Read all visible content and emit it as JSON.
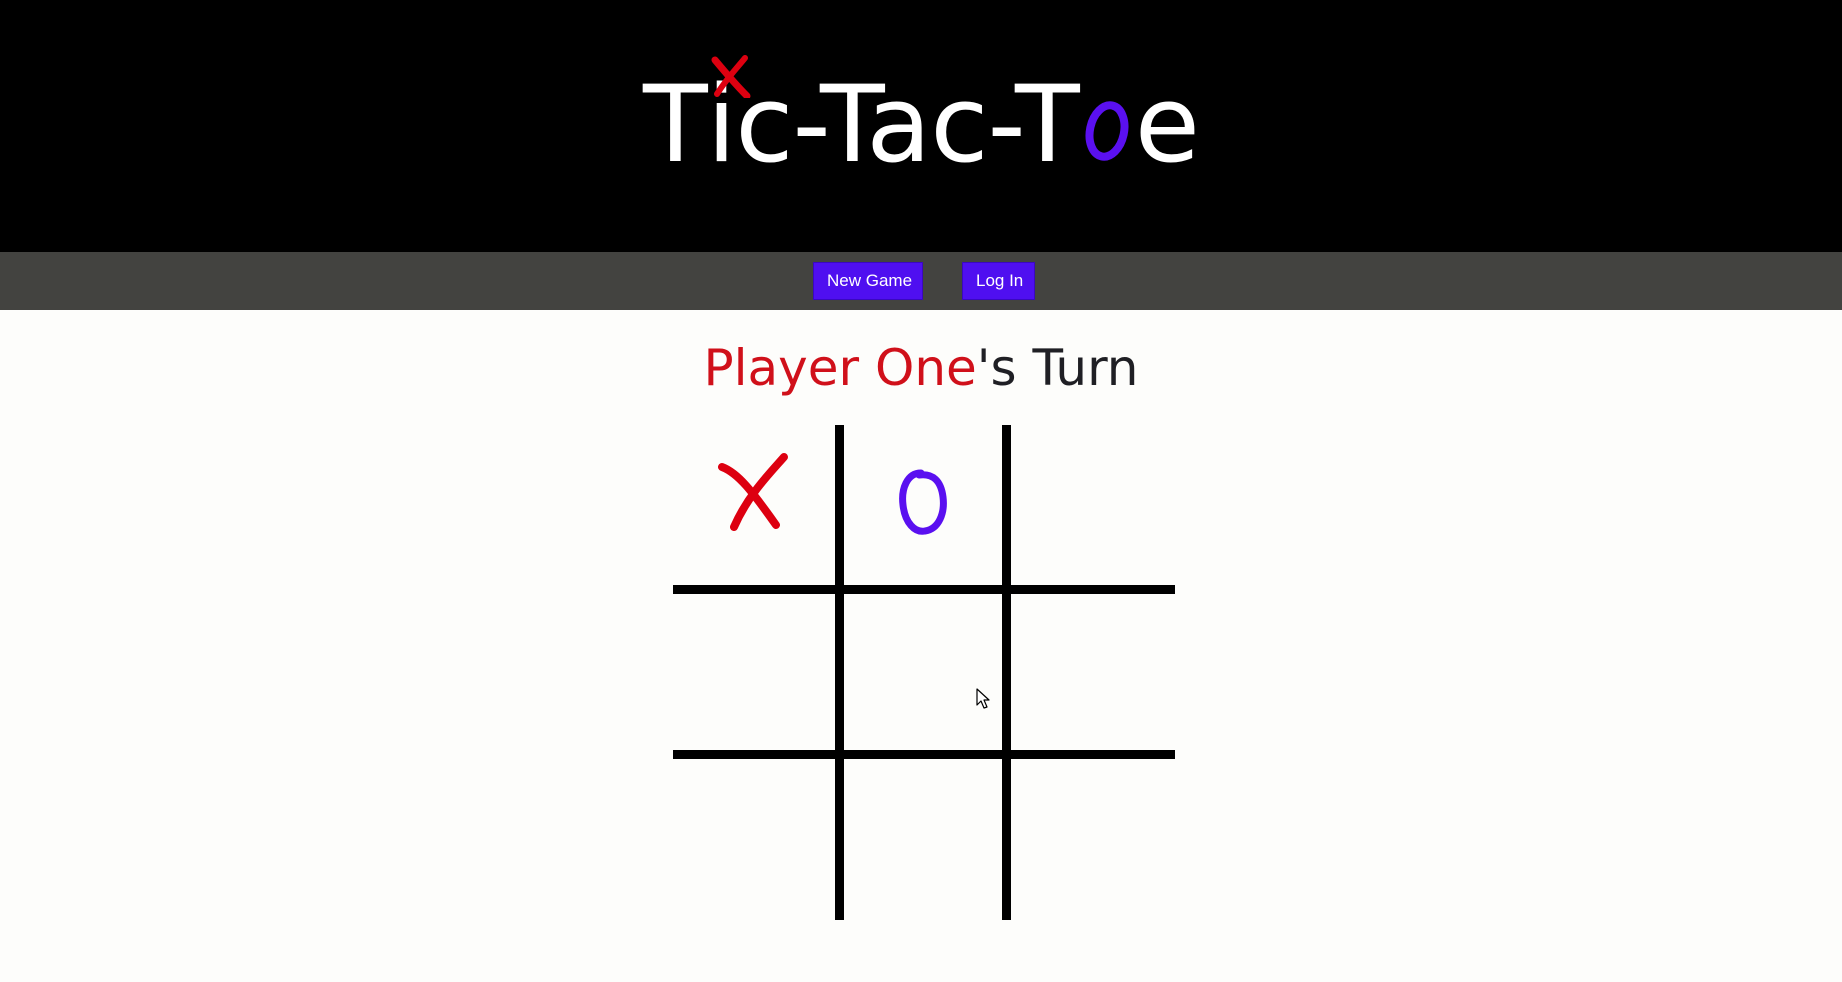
{
  "header": {
    "title_parts": {
      "t1": "T",
      "i": "i",
      "rest1": "c-Tac-T",
      "e": "e"
    },
    "x_icon": "red-x-mark",
    "o_icon": "purple-o-mark"
  },
  "nav": {
    "new_game_label": "New Game",
    "login_label": "Log In"
  },
  "status": {
    "player": "Player One",
    "suffix": "'s Turn"
  },
  "board": {
    "cells": [
      "X",
      "O",
      "",
      "",
      "",
      "",
      "",
      "",
      ""
    ]
  },
  "colors": {
    "x": "#dd0010",
    "o": "#5a10f0",
    "button": "#4f0ff0",
    "header": "#000000",
    "navbar": "#434340",
    "player_one": "#d0101a"
  }
}
